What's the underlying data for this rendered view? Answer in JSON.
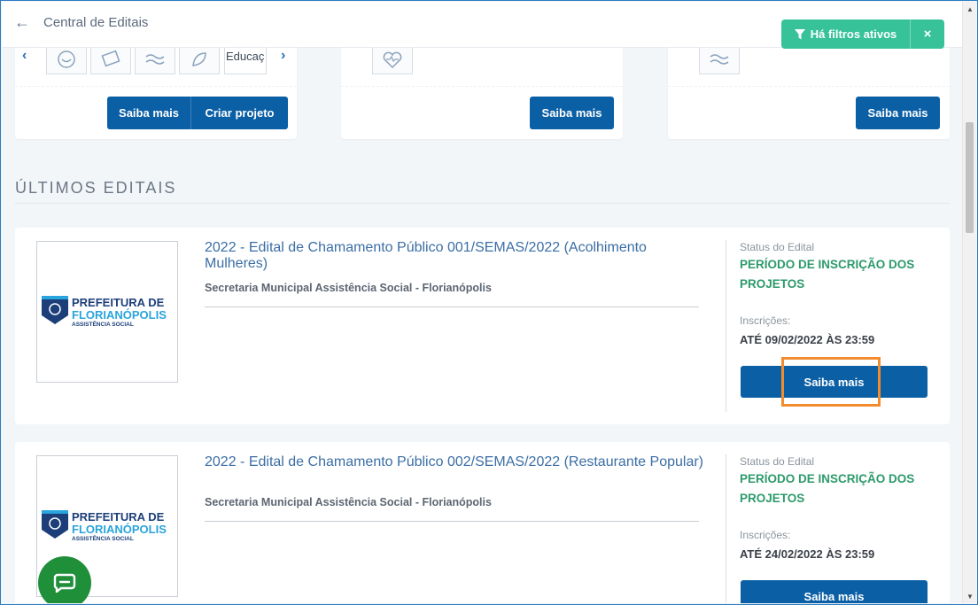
{
  "header": {
    "title": "Central de Editais",
    "filters_label": "Há filtros ativos",
    "filters_close": "×"
  },
  "top_cards": [
    {
      "ods_text": "Educaç",
      "buttons": [
        "Saiba mais",
        "Criar projeto"
      ]
    },
    {
      "buttons": [
        "Saiba mais"
      ]
    },
    {
      "buttons": [
        "Saiba mais"
      ]
    }
  ],
  "section": {
    "title": "ÚLTIMOS EDITAIS"
  },
  "editais": [
    {
      "title": "2022 - Edital de Chamamento Público 001/SEMAS/2022 (Acolhimento Mulheres)",
      "organization": "Secretaria Municipal Assistência Social - Florianópolis",
      "status_label": "Status do Edital",
      "status_value": "PERÍODO DE INSCRIÇÃO DOS PROJETOS",
      "inscricoes_label": "Inscrições:",
      "inscricoes_value": "ATÉ 09/02/2022 ÀS 23:59",
      "button_label": "Saiba mais",
      "logo_line1": "PREFEITURA DE",
      "logo_line2": "FLORIANÓPOLIS",
      "logo_line3": "ASSISTÊNCIA SOCIAL"
    },
    {
      "title": "2022 - Edital de Chamamento Público 002/SEMAS/2022 (Restaurante Popular)",
      "organization": "Secretaria Municipal Assistência Social - Florianópolis",
      "status_label": "Status do Edital",
      "status_value": "PERÍODO DE INSCRIÇÃO DOS PROJETOS",
      "inscricoes_label": "Inscrições:",
      "inscricoes_value": "ATÉ 24/02/2022 ÀS 23:59",
      "button_label": "Saiba mais",
      "logo_line1": "PREFEITURA DE",
      "logo_line2": "FLORIANÓPOLIS",
      "logo_line3": "ASSISTÊNCIA SOCIAL"
    }
  ],
  "colors": {
    "primary": "#0b5fa5",
    "accent_green": "#37c29a",
    "status_green": "#2c9a6b",
    "highlight": "#f28c2e",
    "chat": "#1f8f3a"
  }
}
